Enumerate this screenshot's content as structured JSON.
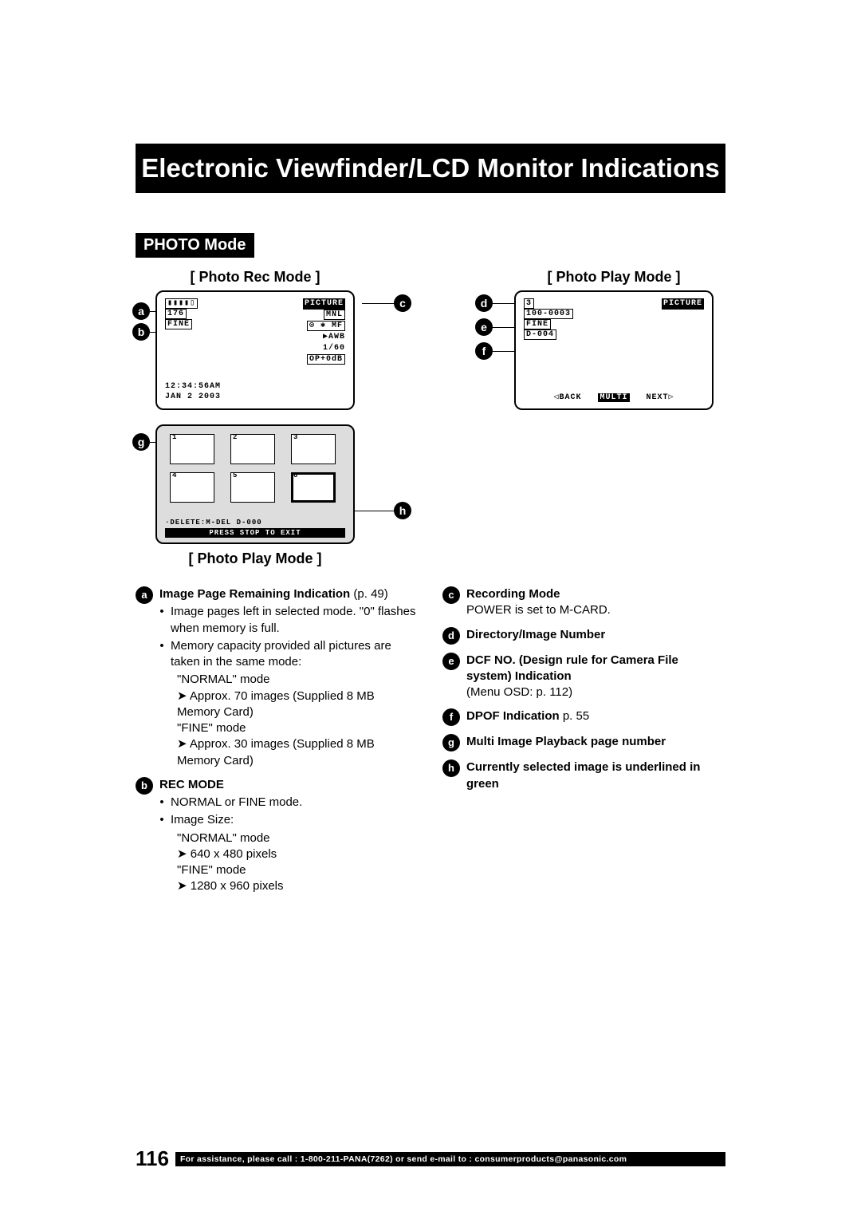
{
  "title": "Electronic Viewfinder/LCD Monitor Indications",
  "section": "PHOTO Mode",
  "rec_mode_label": "[ Photo Rec Mode ]",
  "play_mode_label": "[ Photo Play Mode ]",
  "play_mode_label2": "[ Photo Play Mode ]",
  "lcd_rec": {
    "battery_icon": "▮▮▮▮▯",
    "pages": "176",
    "quality": "FINE",
    "picture": "PICTURE",
    "mnl": "MNL",
    "key_mf": "⊙ ✱  MF",
    "awb": "▶AWB",
    "shutter": "1/60",
    "op": "OP+0dB",
    "time": "12:34:56AM",
    "date": "JAN  2 2003"
  },
  "lcd_play": {
    "num": "3",
    "dcf": "100-0003",
    "quality": "FINE",
    "dpof": "D-004",
    "picture": "PICTURE",
    "back": "◁BACK",
    "multi": "MULTI",
    "next": "NEXT▷"
  },
  "thumb": {
    "cells": [
      "1",
      "2",
      "3",
      "4",
      "5",
      "6"
    ],
    "delete_line": "·DELETE:M-DEL   D-000",
    "exit_line": "PRESS STOP TO EXIT"
  },
  "callouts": {
    "a": "a",
    "b": "b",
    "c": "c",
    "d": "d",
    "e": "e",
    "f": "f",
    "g": "g",
    "h": "h"
  },
  "desc": {
    "a_title": "Image Page Remaining Indication",
    "a_ref": "(p. 49)",
    "a_b1": "Image pages left in selected mode. \"0\" flashes when memory is full.",
    "a_b2": "Memory capacity provided all pictures are taken in the same mode:",
    "a_normal": "\"NORMAL\" mode",
    "a_normal_v": "Approx. 70 images (Supplied 8 MB Memory Card)",
    "a_fine": "\"FINE\" mode",
    "a_fine_v": "Approx. 30 images (Supplied 8 MB Memory Card)",
    "b_title": "REC MODE",
    "b_b1": "NORMAL or FINE mode.",
    "b_b2": "Image Size:",
    "b_normal": "\"NORMAL\" mode",
    "b_normal_v": "640 x 480 pixels",
    "b_fine": "\"FINE\" mode",
    "b_fine_v": "1280 x 960 pixels",
    "c_title": "Recording Mode",
    "c_text": "POWER is set to M-CARD.",
    "d_title": "Directory/Image Number",
    "e_title": "DCF NO. (Design rule for Camera File system) Indication",
    "e_text": "(Menu OSD: p. 112)",
    "f_title": "DPOF Indication",
    "f_ref": " p. 55",
    "g_title": "Multi Image Playback page number",
    "h_title": "Currently selected image is underlined in green"
  },
  "footer": {
    "page": "116",
    "text": "For assistance, please call : 1-800-211-PANA(7262) or send e-mail to : consumerproducts@panasonic.com"
  }
}
